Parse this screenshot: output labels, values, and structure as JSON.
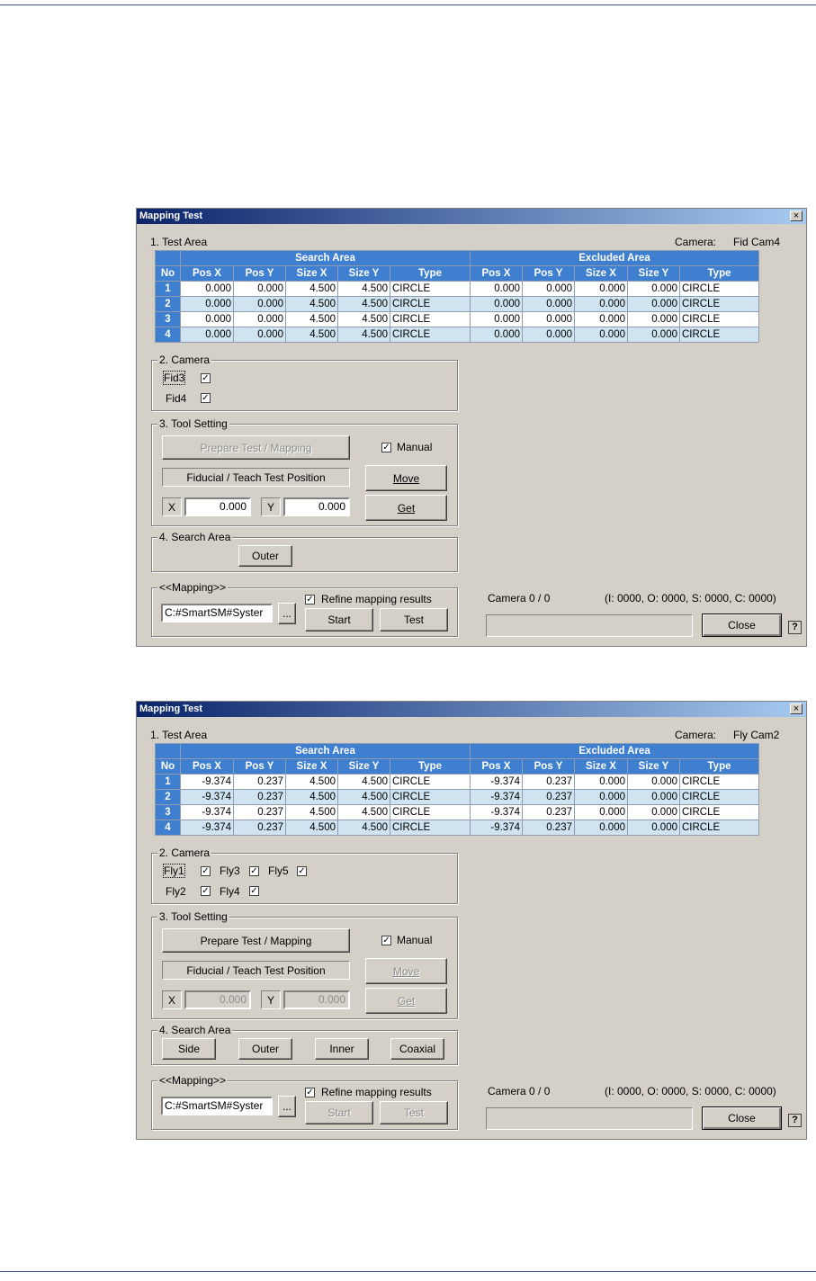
{
  "dialogs": [
    {
      "title": "Mapping Test",
      "close_glyph": "×",
      "test_area_label": "1. Test Area",
      "camera_label": "Camera:",
      "camera_value": "Fid Cam4",
      "table": {
        "group_headers": [
          "Search Area",
          "Excluded Area"
        ],
        "columns": [
          "No",
          "Pos X",
          "Pos Y",
          "Size X",
          "Size Y",
          "Type",
          "Pos X",
          "Pos Y",
          "Size X",
          "Size Y",
          "Type"
        ],
        "rows": [
          [
            "1",
            "0.000",
            "0.000",
            "4.500",
            "4.500",
            "CIRCLE",
            "0.000",
            "0.000",
            "0.000",
            "0.000",
            "CIRCLE"
          ],
          [
            "2",
            "0.000",
            "0.000",
            "4.500",
            "4.500",
            "CIRCLE",
            "0.000",
            "0.000",
            "0.000",
            "0.000",
            "CIRCLE"
          ],
          [
            "3",
            "0.000",
            "0.000",
            "4.500",
            "4.500",
            "CIRCLE",
            "0.000",
            "0.000",
            "0.000",
            "0.000",
            "CIRCLE"
          ],
          [
            "4",
            "0.000",
            "0.000",
            "4.500",
            "4.500",
            "CIRCLE",
            "0.000",
            "0.000",
            "0.000",
            "0.000",
            "CIRCLE"
          ]
        ]
      },
      "camera_group": {
        "label": "2. Camera",
        "checkboxes": [
          {
            "label": "Fid3",
            "checked": true
          },
          {
            "label": "Fid4",
            "checked": true
          }
        ]
      },
      "tool_setting": {
        "label": "3. Tool Setting",
        "prepare_button": "Prepare Test / Mapping",
        "prepare_enabled": false,
        "manual_label": "Manual",
        "manual_checked": true,
        "teach_position_label": "Fiducial / Teach Test Position",
        "move_button": "Move",
        "get_button": "Get",
        "x_label": "X",
        "x_value": "0.000",
        "y_label": "Y",
        "y_value": "0.000"
      },
      "search_area": {
        "label": "4. Search Area",
        "buttons": [
          "Outer"
        ]
      },
      "mapping": {
        "label": "<<Mapping>>",
        "path": "C:#SmartSM#Syster",
        "browse_button": "...",
        "refine_label": "Refine mapping results",
        "refine_checked": true,
        "start_button": "Start",
        "test_button": "Test"
      },
      "status": {
        "camera_count": "Camera 0 / 0",
        "counts": "(I: 0000, O: 0000, S: 0000, C: 0000)"
      },
      "close_button": "Close",
      "help_button": "?"
    },
    {
      "title": "Mapping Test",
      "close_glyph": "×",
      "test_area_label": "1. Test Area",
      "camera_label": "Camera:",
      "camera_value": "Fly Cam2",
      "table": {
        "group_headers": [
          "Search Area",
          "Excluded Area"
        ],
        "columns": [
          "No",
          "Pos X",
          "Pos Y",
          "Size X",
          "Size Y",
          "Type",
          "Pos X",
          "Pos Y",
          "Size X",
          "Size Y",
          "Type"
        ],
        "rows": [
          [
            "1",
            "-9.374",
            "0.237",
            "4.500",
            "4.500",
            "CIRCLE",
            "-9.374",
            "0.237",
            "0.000",
            "0.000",
            "CIRCLE"
          ],
          [
            "2",
            "-9.374",
            "0.237",
            "4.500",
            "4.500",
            "CIRCLE",
            "-9.374",
            "0.237",
            "0.000",
            "0.000",
            "CIRCLE"
          ],
          [
            "3",
            "-9.374",
            "0.237",
            "4.500",
            "4.500",
            "CIRCLE",
            "-9.374",
            "0.237",
            "0.000",
            "0.000",
            "CIRCLE"
          ],
          [
            "4",
            "-9.374",
            "0.237",
            "4.500",
            "4.500",
            "CIRCLE",
            "-9.374",
            "0.237",
            "0.000",
            "0.000",
            "CIRCLE"
          ]
        ]
      },
      "camera_group": {
        "label": "2. Camera",
        "checkboxes": [
          {
            "label": "Fly1",
            "checked": true
          },
          {
            "label": "Fly3",
            "checked": true
          },
          {
            "label": "Fly5",
            "checked": true
          },
          {
            "label": "Fly2",
            "checked": true
          },
          {
            "label": "Fly4",
            "checked": true
          }
        ]
      },
      "tool_setting": {
        "label": "3. Tool Setting",
        "prepare_button": "Prepare Test / Mapping",
        "prepare_enabled": true,
        "manual_label": "Manual",
        "manual_checked": true,
        "teach_position_label": "Fiducial / Teach Test Position",
        "move_button": "Move",
        "get_button": "Get",
        "x_label": "X",
        "x_value": "0.000",
        "y_label": "Y",
        "y_value": "0.000"
      },
      "search_area": {
        "label": "4. Search Area",
        "buttons": [
          "Side",
          "Outer",
          "Inner",
          "Coaxial"
        ]
      },
      "mapping": {
        "label": "<<Mapping>>",
        "path": "C:#SmartSM#Syster",
        "browse_button": "...",
        "refine_label": "Refine mapping results",
        "refine_checked": true,
        "start_button": "Start",
        "test_button": "Test"
      },
      "status": {
        "camera_count": "Camera 0 / 0",
        "counts": "(I: 0000, O: 0000, S: 0000, C: 0000)"
      },
      "close_button": "Close",
      "help_button": "?"
    }
  ],
  "check_glyph": "✓"
}
